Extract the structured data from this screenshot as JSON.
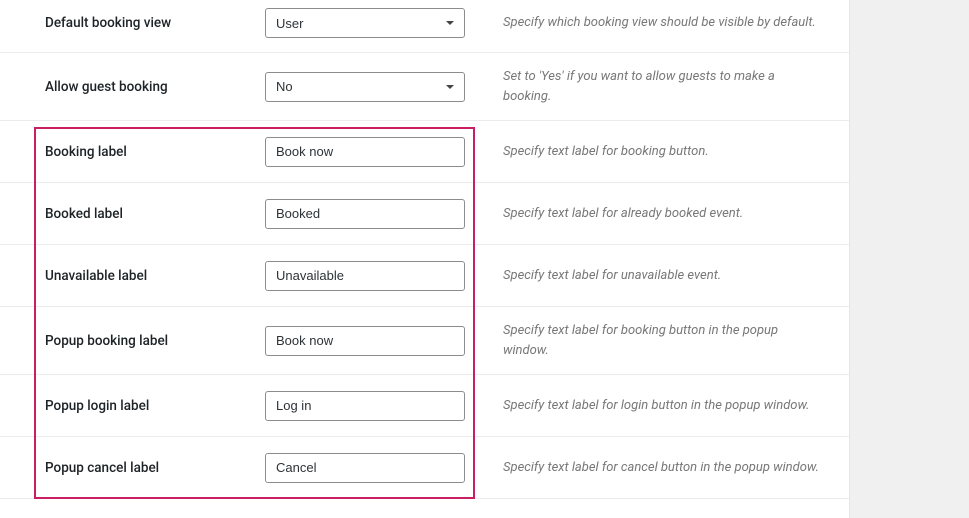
{
  "rows": {
    "default_booking_view": {
      "label": "Default booking view",
      "value": "User",
      "desc": "Specify which booking view should be visible by default."
    },
    "allow_guest_booking": {
      "label": "Allow guest booking",
      "value": "No",
      "desc": "Set to 'Yes' if you want to allow guests to make a booking."
    },
    "booking_label": {
      "label": "Booking label",
      "value": "Book now",
      "desc": "Specify text label for booking button."
    },
    "booked_label": {
      "label": "Booked label",
      "value": "Booked",
      "desc": "Specify text label for already booked event."
    },
    "unavailable_label": {
      "label": "Unavailable label",
      "value": "Unavailable",
      "desc": "Specify text label for unavailable event."
    },
    "popup_booking_label": {
      "label": "Popup booking label",
      "value": "Book now",
      "desc": "Specify text label for booking button in the popup window."
    },
    "popup_login_label": {
      "label": "Popup login label",
      "value": "Log in",
      "desc": "Specify text label for login button in the popup window."
    },
    "popup_cancel_label": {
      "label": "Popup cancel label",
      "value": "Cancel",
      "desc": "Specify text label for cancel button in the popup window."
    }
  }
}
